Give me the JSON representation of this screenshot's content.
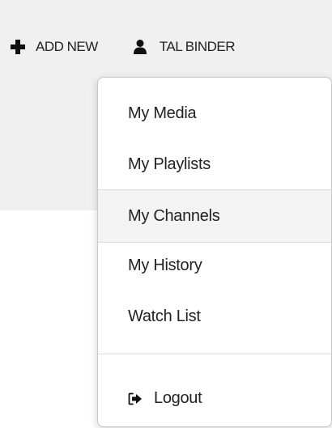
{
  "header": {
    "add_new_label": "ADD NEW",
    "user_label": "TAL BINDER"
  },
  "menu": {
    "items": [
      {
        "label": "My Media"
      },
      {
        "label": "My Playlists"
      },
      {
        "label": "My Channels"
      },
      {
        "label": "My History"
      },
      {
        "label": "Watch List"
      }
    ],
    "logout_label": "Logout"
  },
  "colors": {
    "header_background": "#f0f0f0",
    "menu_background": "#ffffff",
    "hover_background": "#f3f3f3",
    "text": "#222222"
  },
  "icons": {
    "add_new": "plus-icon",
    "user": "user-icon",
    "logout": "logout-icon"
  }
}
